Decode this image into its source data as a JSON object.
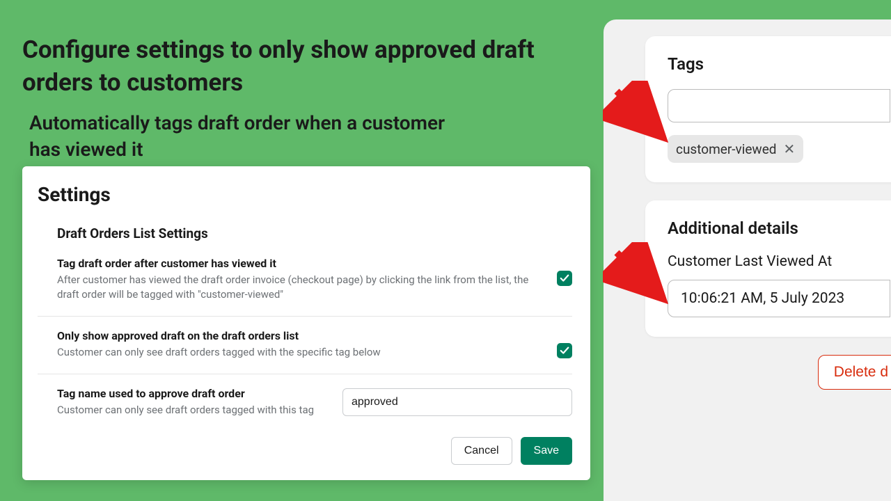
{
  "hero": {
    "title": "Configure settings to only show approved draft orders to customers",
    "subtitle": "Automatically tags draft order when a customer has viewed it"
  },
  "settings": {
    "title": "Settings",
    "section": "Draft Orders List Settings",
    "row1": {
      "label": "Tag draft order after customer has viewed it",
      "desc": "After customer has viewed the draft order invoice (checkout page) by clicking the link from the list, the draft order will be tagged with \"customer-viewed\""
    },
    "row2": {
      "label": "Only show approved draft on the draft orders list",
      "desc": "Customer can only see draft orders tagged with the specific tag below"
    },
    "row3": {
      "label": "Tag name used to approve draft order",
      "desc": "Customer can only see draft orders tagged with this tag",
      "value": "approved"
    },
    "cancel": "Cancel",
    "save": "Save"
  },
  "tags_card": {
    "title": "Tags",
    "chip": "customer-viewed"
  },
  "details_card": {
    "title": "Additional details",
    "label": "Customer Last Viewed At",
    "value": "10:06:21 AM, 5 July 2023"
  },
  "delete": "Delete d"
}
